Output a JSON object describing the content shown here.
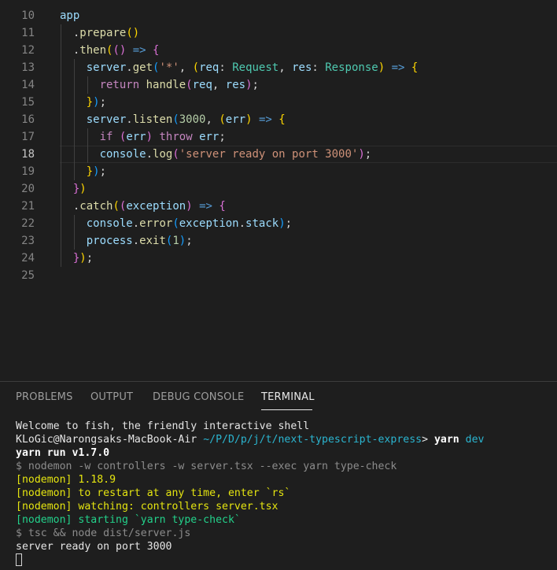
{
  "editor": {
    "line_numbers": [
      "10",
      "11",
      "12",
      "13",
      "14",
      "15",
      "16",
      "17",
      "18",
      "19",
      "20",
      "21",
      "22",
      "23",
      "24",
      "25"
    ],
    "active_line": "18",
    "lines": [
      [
        {
          "t": "app",
          "c": "#9cdcfe"
        }
      ],
      [
        {
          "t": "  .",
          "c": "#d4d4d4"
        },
        {
          "t": "prepare",
          "c": "#dcdcaa"
        },
        {
          "t": "()",
          "c": "#ffd700"
        }
      ],
      [
        {
          "t": "  .",
          "c": "#d4d4d4"
        },
        {
          "t": "then",
          "c": "#dcdcaa"
        },
        {
          "t": "(",
          "c": "#ffd700"
        },
        {
          "t": "()",
          "c": "#da70d6"
        },
        {
          "t": " ",
          "c": "#d4d4d4"
        },
        {
          "t": "=>",
          "c": "#569cd6"
        },
        {
          "t": " ",
          "c": "#d4d4d4"
        },
        {
          "t": "{",
          "c": "#da70d6"
        }
      ],
      [
        {
          "t": "    server",
          "c": "#9cdcfe"
        },
        {
          "t": ".",
          "c": "#d4d4d4"
        },
        {
          "t": "get",
          "c": "#dcdcaa"
        },
        {
          "t": "(",
          "c": "#179fff"
        },
        {
          "t": "'*'",
          "c": "#ce9178"
        },
        {
          "t": ", ",
          "c": "#d4d4d4"
        },
        {
          "t": "(",
          "c": "#ffd700"
        },
        {
          "t": "req",
          "c": "#9cdcfe"
        },
        {
          "t": ": ",
          "c": "#d4d4d4"
        },
        {
          "t": "Request",
          "c": "#4ec9b0"
        },
        {
          "t": ", ",
          "c": "#d4d4d4"
        },
        {
          "t": "res",
          "c": "#9cdcfe"
        },
        {
          "t": ": ",
          "c": "#d4d4d4"
        },
        {
          "t": "Response",
          "c": "#4ec9b0"
        },
        {
          "t": ")",
          "c": "#ffd700"
        },
        {
          "t": " ",
          "c": "#d4d4d4"
        },
        {
          "t": "=>",
          "c": "#569cd6"
        },
        {
          "t": " ",
          "c": "#d4d4d4"
        },
        {
          "t": "{",
          "c": "#ffd700"
        }
      ],
      [
        {
          "t": "      ",
          "c": "#d4d4d4"
        },
        {
          "t": "return",
          "c": "#c586c0"
        },
        {
          "t": " ",
          "c": "#d4d4d4"
        },
        {
          "t": "handle",
          "c": "#dcdcaa"
        },
        {
          "t": "(",
          "c": "#da70d6"
        },
        {
          "t": "req",
          "c": "#9cdcfe"
        },
        {
          "t": ", ",
          "c": "#d4d4d4"
        },
        {
          "t": "res",
          "c": "#9cdcfe"
        },
        {
          "t": ")",
          "c": "#da70d6"
        },
        {
          "t": ";",
          "c": "#d4d4d4"
        }
      ],
      [
        {
          "t": "    ",
          "c": "#d4d4d4"
        },
        {
          "t": "}",
          "c": "#ffd700"
        },
        {
          "t": ")",
          "c": "#179fff"
        },
        {
          "t": ";",
          "c": "#d4d4d4"
        }
      ],
      [
        {
          "t": "    server",
          "c": "#9cdcfe"
        },
        {
          "t": ".",
          "c": "#d4d4d4"
        },
        {
          "t": "listen",
          "c": "#dcdcaa"
        },
        {
          "t": "(",
          "c": "#179fff"
        },
        {
          "t": "3000",
          "c": "#b5cea8"
        },
        {
          "t": ", ",
          "c": "#d4d4d4"
        },
        {
          "t": "(",
          "c": "#ffd700"
        },
        {
          "t": "err",
          "c": "#9cdcfe"
        },
        {
          "t": ")",
          "c": "#ffd700"
        },
        {
          "t": " ",
          "c": "#d4d4d4"
        },
        {
          "t": "=>",
          "c": "#569cd6"
        },
        {
          "t": " ",
          "c": "#d4d4d4"
        },
        {
          "t": "{",
          "c": "#ffd700"
        }
      ],
      [
        {
          "t": "      ",
          "c": "#d4d4d4"
        },
        {
          "t": "if",
          "c": "#c586c0"
        },
        {
          "t": " ",
          "c": "#d4d4d4"
        },
        {
          "t": "(",
          "c": "#da70d6"
        },
        {
          "t": "err",
          "c": "#9cdcfe"
        },
        {
          "t": ")",
          "c": "#da70d6"
        },
        {
          "t": " ",
          "c": "#d4d4d4"
        },
        {
          "t": "throw",
          "c": "#c586c0"
        },
        {
          "t": " ",
          "c": "#d4d4d4"
        },
        {
          "t": "err",
          "c": "#9cdcfe"
        },
        {
          "t": ";",
          "c": "#d4d4d4"
        }
      ],
      [
        {
          "t": "      console",
          "c": "#9cdcfe"
        },
        {
          "t": ".",
          "c": "#d4d4d4"
        },
        {
          "t": "log",
          "c": "#dcdcaa"
        },
        {
          "t": "(",
          "c": "#da70d6"
        },
        {
          "t": "'server ready on port 3000'",
          "c": "#ce9178"
        },
        {
          "t": ")",
          "c": "#da70d6"
        },
        {
          "t": ";",
          "c": "#d4d4d4"
        }
      ],
      [
        {
          "t": "    ",
          "c": "#d4d4d4"
        },
        {
          "t": "}",
          "c": "#ffd700"
        },
        {
          "t": ")",
          "c": "#179fff"
        },
        {
          "t": ";",
          "c": "#d4d4d4"
        }
      ],
      [
        {
          "t": "  ",
          "c": "#d4d4d4"
        },
        {
          "t": "}",
          "c": "#da70d6"
        },
        {
          "t": ")",
          "c": "#ffd700"
        }
      ],
      [
        {
          "t": "  .",
          "c": "#d4d4d4"
        },
        {
          "t": "catch",
          "c": "#dcdcaa"
        },
        {
          "t": "(",
          "c": "#ffd700"
        },
        {
          "t": "(",
          "c": "#da70d6"
        },
        {
          "t": "exception",
          "c": "#9cdcfe"
        },
        {
          "t": ")",
          "c": "#da70d6"
        },
        {
          "t": " ",
          "c": "#d4d4d4"
        },
        {
          "t": "=>",
          "c": "#569cd6"
        },
        {
          "t": " ",
          "c": "#d4d4d4"
        },
        {
          "t": "{",
          "c": "#da70d6"
        }
      ],
      [
        {
          "t": "    console",
          "c": "#9cdcfe"
        },
        {
          "t": ".",
          "c": "#d4d4d4"
        },
        {
          "t": "error",
          "c": "#dcdcaa"
        },
        {
          "t": "(",
          "c": "#179fff"
        },
        {
          "t": "exception",
          "c": "#9cdcfe"
        },
        {
          "t": ".",
          "c": "#d4d4d4"
        },
        {
          "t": "stack",
          "c": "#9cdcfe"
        },
        {
          "t": ")",
          "c": "#179fff"
        },
        {
          "t": ";",
          "c": "#d4d4d4"
        }
      ],
      [
        {
          "t": "    process",
          "c": "#9cdcfe"
        },
        {
          "t": ".",
          "c": "#d4d4d4"
        },
        {
          "t": "exit",
          "c": "#dcdcaa"
        },
        {
          "t": "(",
          "c": "#179fff"
        },
        {
          "t": "1",
          "c": "#b5cea8"
        },
        {
          "t": ")",
          "c": "#179fff"
        },
        {
          "t": ";",
          "c": "#d4d4d4"
        }
      ],
      [
        {
          "t": "  ",
          "c": "#d4d4d4"
        },
        {
          "t": "}",
          "c": "#da70d6"
        },
        {
          "t": ")",
          "c": "#ffd700"
        },
        {
          "t": ";",
          "c": "#d4d4d4"
        }
      ],
      []
    ]
  },
  "panel": {
    "tabs": [
      "PROBLEMS",
      "OUTPUT",
      "DEBUG CONSOLE",
      "TERMINAL"
    ],
    "active_tab": "TERMINAL"
  },
  "terminal": {
    "lines": [
      [
        {
          "t": "Welcome to fish, the friendly interactive shell",
          "c": "#e5e5e5"
        }
      ],
      [
        {
          "t": "KLoGic@Narongsaks-MacBook-Air ",
          "c": "#e5e5e5"
        },
        {
          "t": "~/P/D/p/j/t/next-typescript-express",
          "c": "#2bb5d0"
        },
        {
          "t": "> ",
          "c": "#e5e5e5"
        },
        {
          "t": "yarn",
          "c": "#ffffff",
          "b": true
        },
        {
          "t": " dev",
          "c": "#2bb5d0"
        }
      ],
      [
        {
          "t": "yarn run v1.7.0",
          "c": "#ffffff",
          "b": true
        }
      ],
      [
        {
          "t": "$ nodemon -w controllers -w server.tsx --exec yarn type-check",
          "c": "#8c8c8c"
        }
      ],
      [
        {
          "t": "[nodemon] 1.18.9",
          "c": "#e5e510"
        }
      ],
      [
        {
          "t": "[nodemon] to restart at any time, enter `rs`",
          "c": "#e5e510"
        }
      ],
      [
        {
          "t": "[nodemon] watching: controllers server.tsx",
          "c": "#e5e510"
        }
      ],
      [
        {
          "t": "[nodemon] starting `yarn type-check`",
          "c": "#23d18b"
        }
      ],
      [
        {
          "t": "$ tsc && node dist/server.js",
          "c": "#8c8c8c"
        }
      ],
      [
        {
          "t": "server ready on port 3000",
          "c": "#e5e5e5"
        }
      ]
    ]
  }
}
